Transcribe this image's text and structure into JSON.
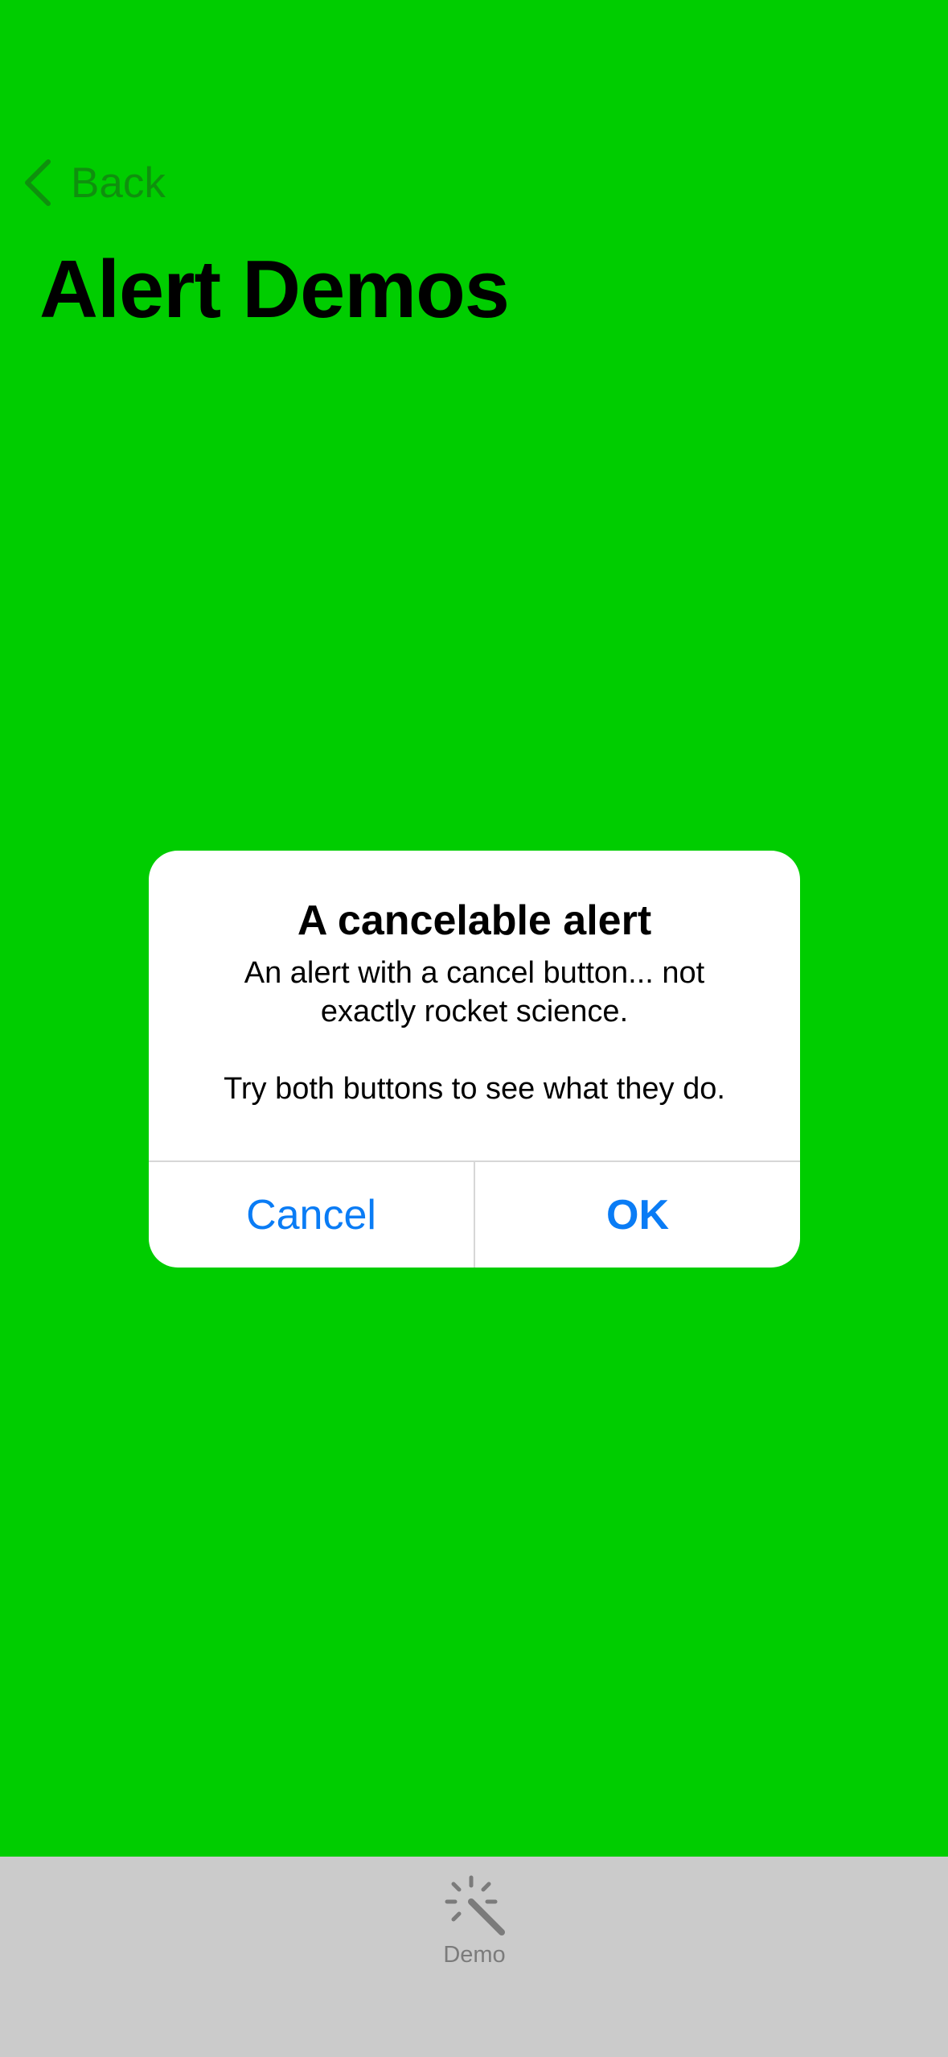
{
  "nav": {
    "back_label": "Back",
    "back_icon": "chevron-left-icon"
  },
  "page": {
    "title": "Alert Demos",
    "background_color": "#00cd00"
  },
  "alert": {
    "title": "A cancelable alert",
    "message": "An alert with a cancel button... not\nexactly rocket science.\n\nTry both buttons to see what they do.",
    "cancel_label": "Cancel",
    "ok_label": "OK",
    "button_color": "#0a7cf5"
  },
  "tab_bar": {
    "items": [
      {
        "label": "Demo",
        "icon": "magic-wand-icon"
      }
    ]
  }
}
